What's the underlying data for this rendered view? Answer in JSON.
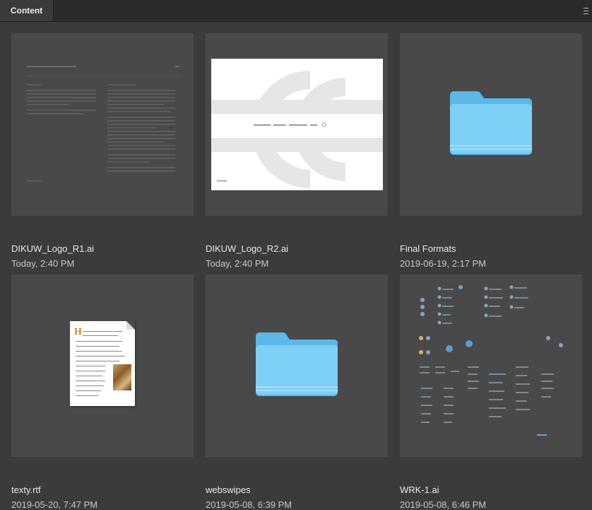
{
  "panel": {
    "tab_label": "Content",
    "menu_icon": "hamburger-icon"
  },
  "items": [
    {
      "name": "DIKUW_Logo_R1.ai",
      "date": "Today, 2:40 PM",
      "kind": "ai-document"
    },
    {
      "name": "DIKUW_Logo_R2.ai",
      "date": "Today, 2:40 PM",
      "kind": "ai-artboard"
    },
    {
      "name": "Final Formats",
      "date": "2019-06-19, 2:17 PM",
      "kind": "folder"
    },
    {
      "name": "texty.rtf",
      "date": "2019-05-20, 7:47 PM",
      "kind": "rtf"
    },
    {
      "name": "webswipes",
      "date": "2019-05-08, 6:39 PM",
      "kind": "folder"
    },
    {
      "name": "WRK-1.ai",
      "date": "2019-05-08, 6:46 PM",
      "kind": "ai-artboard"
    }
  ],
  "rtf_preview": {
    "drop_cap": "H"
  },
  "colors": {
    "panel_bg": "#3b3b3b",
    "thumb_bg": "#494949",
    "folder_blue": "#6cc7f2",
    "accent_text": "#e8e8e8"
  }
}
